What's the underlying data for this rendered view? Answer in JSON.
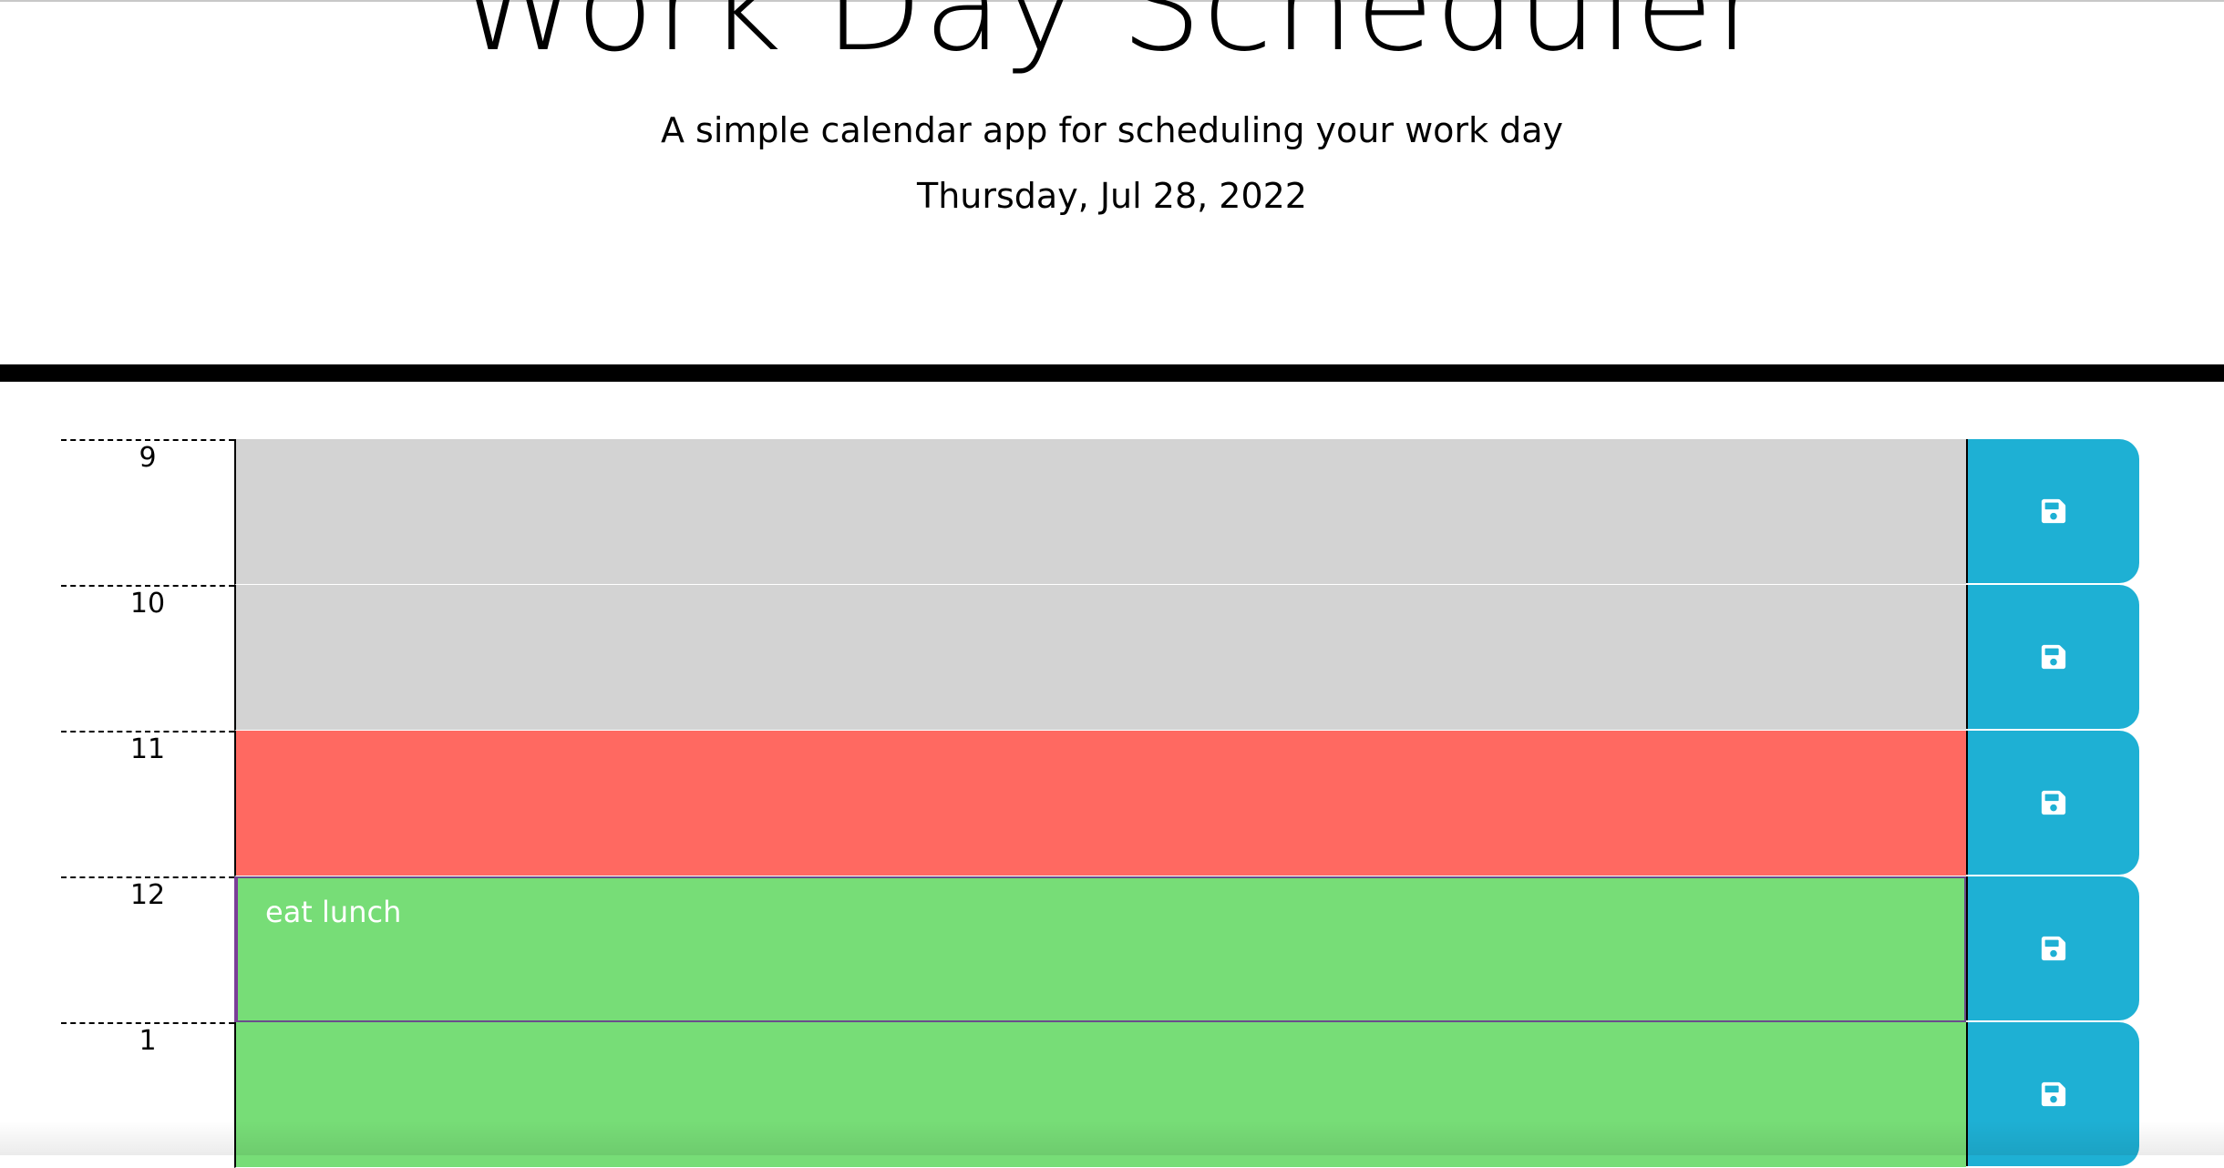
{
  "header": {
    "title": "Work Day Scheduler",
    "subtitle": "A simple calendar app for scheduling your work day",
    "current_day": "Thursday, Jul 28, 2022"
  },
  "time_blocks": [
    {
      "hour": "9",
      "text": "",
      "status": "past"
    },
    {
      "hour": "10",
      "text": "",
      "status": "past"
    },
    {
      "hour": "11",
      "text": "",
      "status": "present"
    },
    {
      "hour": "12",
      "text": "eat lunch",
      "status": "future"
    },
    {
      "hour": "1",
      "text": "",
      "status": "future"
    }
  ],
  "save_icon": "floppy-disk-icon",
  "colors": {
    "past": "#d3d3d3",
    "present": "#ff6961",
    "future": "#77dd77",
    "save_button": "#1eb0d4"
  }
}
